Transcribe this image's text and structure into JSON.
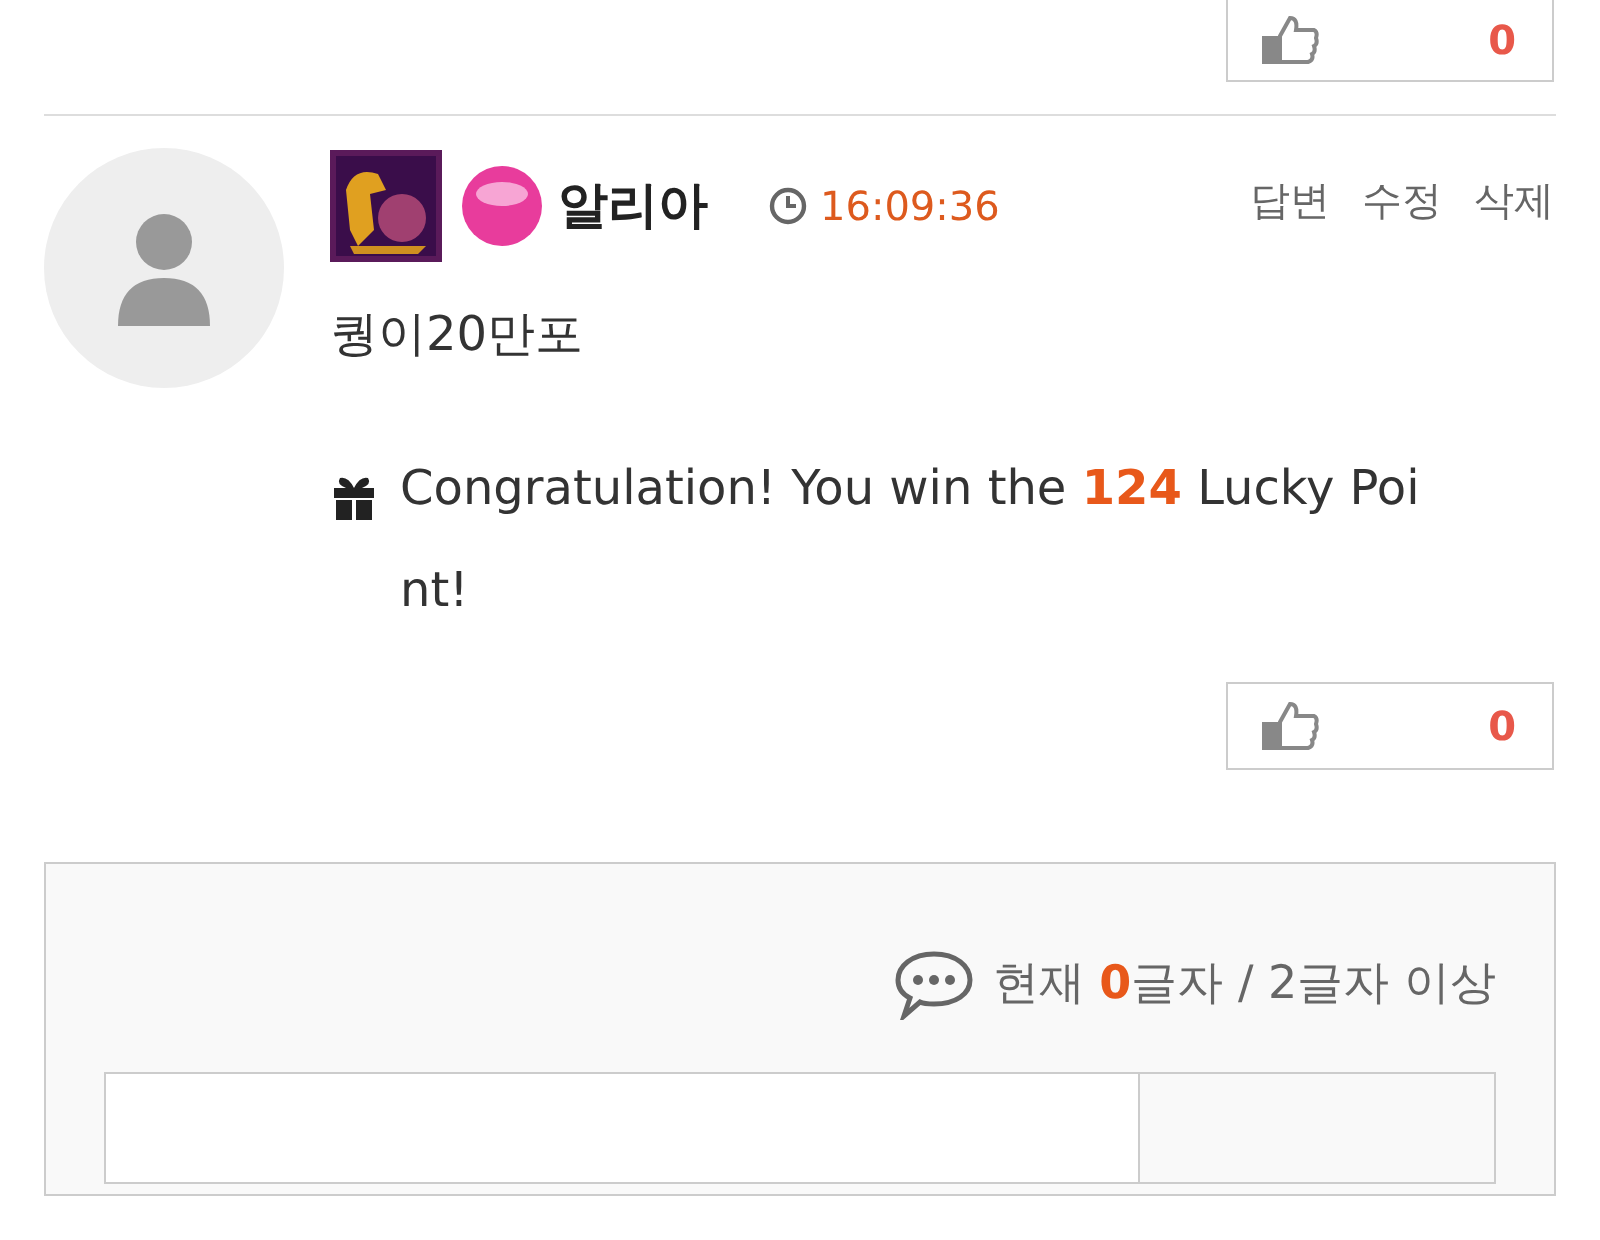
{
  "top_like": {
    "count": "0"
  },
  "comment": {
    "author": "알리아",
    "time": "16:09:36",
    "actions": [
      "답변",
      "수정",
      "삭제"
    ],
    "body": "퀑이20만포",
    "message": "Congratulation! You win the **124** Lucky Point!",
    "like": {
      "count": "0"
    }
  },
  "reply_form": {
    "counter_prefix": "현재",
    "count": "0",
    "counter_suffix": "글자 / 2글자 이상"
  }
}
